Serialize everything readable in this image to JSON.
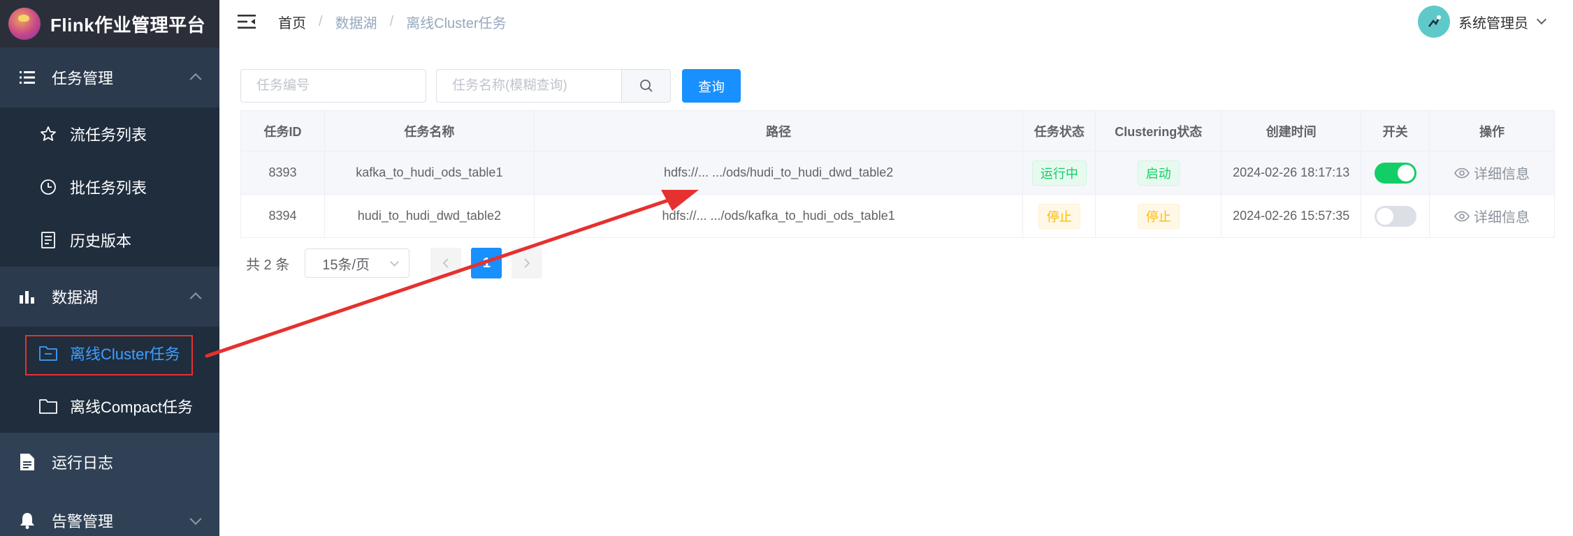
{
  "app": {
    "title": "Flink作业管理平台"
  },
  "sidebar": {
    "groups": [
      {
        "label": "任务管理",
        "icon": "list-icon",
        "expanded": true,
        "items": [
          {
            "label": "流任务列表",
            "icon": "star-icon"
          },
          {
            "label": "批任务列表",
            "icon": "clock-icon"
          },
          {
            "label": "历史版本",
            "icon": "document-icon"
          }
        ]
      },
      {
        "label": "数据湖",
        "icon": "bar-chart-icon",
        "expanded": true,
        "items": [
          {
            "label": "离线Cluster任务",
            "icon": "folder-icon",
            "active": true
          },
          {
            "label": "离线Compact任务",
            "icon": "folder-icon"
          }
        ]
      },
      {
        "label": "运行日志",
        "icon": "file-text-icon"
      },
      {
        "label": "告警管理",
        "icon": "bell-icon",
        "expanded": false
      }
    ]
  },
  "header": {
    "breadcrumb": [
      "首页",
      "数据湖",
      "离线Cluster任务"
    ],
    "user_name": "系统管理员"
  },
  "search": {
    "task_id_placeholder": "任务编号",
    "task_name_placeholder": "任务名称(模糊查询)",
    "query_label": "查询"
  },
  "table": {
    "columns": [
      "任务ID",
      "任务名称",
      "路径",
      "任务状态",
      "Clustering状态",
      "创建时间",
      "开关",
      "操作"
    ],
    "rows": [
      {
        "id": "8393",
        "name": "kafka_to_hudi_ods_table1",
        "path": "hdfs://... .../ods/hudi_to_hudi_dwd_table2",
        "status": "运行中",
        "clustering": "启动",
        "created": "2024-02-26 18:17:13",
        "switch_on": true,
        "action": "详细信息"
      },
      {
        "id": "8394",
        "name": "hudi_to_hudi_dwd_table2",
        "path": "hdfs://... .../ods/kafka_to_hudi_ods_table1",
        "status": "停止",
        "clustering": "停止",
        "created": "2024-02-26 15:57:35",
        "switch_on": false,
        "action": "详细信息"
      }
    ]
  },
  "pagination": {
    "total": "共 2 条",
    "page_size": "15条/页",
    "current_page": "1"
  },
  "colors": {
    "sidebar_bg": "#304156",
    "accent": "#1890ff",
    "success": "#13ce66",
    "warning": "#ffba00",
    "annotation_red": "#e5312f"
  }
}
